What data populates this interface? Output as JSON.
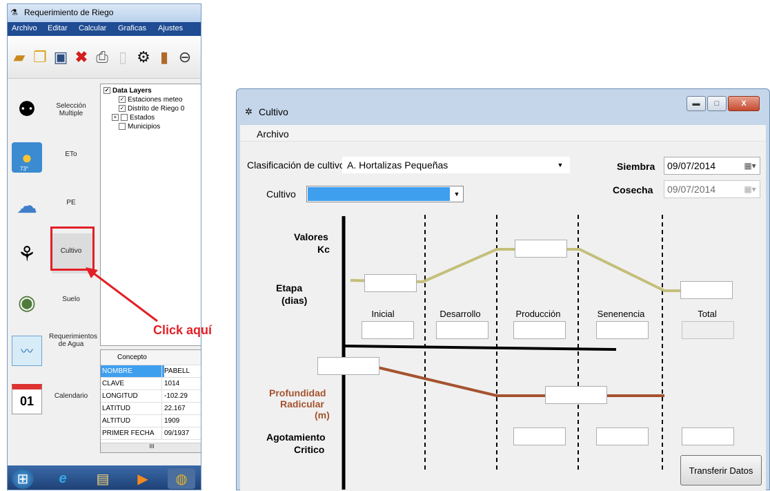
{
  "left_app": {
    "title": "Requerimiento de Riego",
    "menu": [
      "Archivo",
      "Editar",
      "Calcular",
      "Graficas",
      "Ajustes"
    ],
    "sidebar": [
      {
        "label": "Selección Multiple",
        "icon": "multi-select-icon"
      },
      {
        "label": "ETo",
        "icon": "sun-icon",
        "badge": "73°"
      },
      {
        "label": "PE",
        "icon": "rain-cloud-icon"
      },
      {
        "label": "Cultivo",
        "icon": "plant-icon"
      },
      {
        "label": "Suelo",
        "icon": "soil-field-icon"
      },
      {
        "label": "Requerimientos de Agua",
        "icon": "water-chart-icon"
      },
      {
        "label": "Calendario",
        "icon": "calendar-icon",
        "badge": "01"
      }
    ],
    "layers": {
      "root": "Data Layers",
      "items": [
        "Estaciones meteo",
        "Distrito de Riego 0",
        "Estados",
        "Municipios"
      ]
    },
    "props_table": {
      "header": [
        "Concepto",
        ""
      ],
      "rows": [
        [
          "NOMBRE",
          "PABELL"
        ],
        [
          "CLAVE",
          "1014"
        ],
        [
          "LONGITUD",
          "-102.29"
        ],
        [
          "LATITUD",
          "22.167"
        ],
        [
          "ALTITUD",
          "1909"
        ],
        [
          "PRIMER FECHA",
          "09/1937"
        ]
      ],
      "scroll_glyph": "III"
    },
    "callout": "Click aquí"
  },
  "cultivo": {
    "title": "Cultivo",
    "menu": "Archivo",
    "clasificacion_label": "Clasificación de cultivo",
    "clasificacion_value": "A. Hortalizas Pequeñas",
    "cultivo_label": "Cultivo",
    "siembra_label": "Siembra",
    "siembra_value": "09/07/2014",
    "cosecha_label": "Cosecha",
    "cosecha_value": "09/07/2014",
    "kc_label_1": "Valores",
    "kc_label_2": "Kc",
    "etapa_label_1": "Etapa",
    "etapa_label_2": "(dias)",
    "prof_label_1": "Profundidad",
    "prof_label_2": "Radicular",
    "prof_label_3": "(m)",
    "agot_label_1": "Agotamiento",
    "agot_label_2": "Critico",
    "stages": [
      "Inicial",
      "Desarrollo",
      "Producción",
      "Senenencia",
      "Total"
    ],
    "transfer_button": "Transferir Datos",
    "colors": {
      "kc_line": "#c4bf7a",
      "root_line": "#a5532f",
      "selection": "#3f9fef"
    }
  }
}
